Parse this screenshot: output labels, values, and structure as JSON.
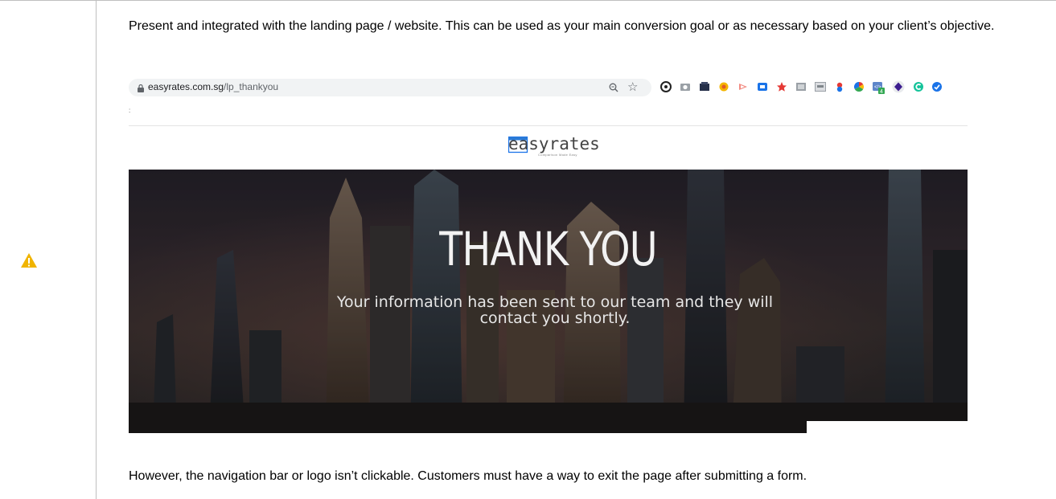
{
  "doc": {
    "intro": "Present and integrated with the landing page / website. This can be used as your main conversion goal or as necessary based on your client’s objective.",
    "outro": "However, the navigation bar or logo isn’t clickable. Customers must have a way to exit the page after submitting a form.",
    "warning_icon": "warning-triangle-icon",
    "warning_color": "#f0b400"
  },
  "browser": {
    "url_host": "easyrates.com.sg",
    "url_path": "/lp_thankyou",
    "icons": [
      "lock-icon",
      "zoom-icon",
      "star-icon"
    ],
    "extension_icons": [
      "extension-icon-1",
      "extension-icon-2",
      "extension-icon-3",
      "extension-icon-4",
      "extension-icon-5",
      "extension-icon-6",
      "extension-icon-7",
      "extension-icon-8",
      "extension-icon-9",
      "extension-icon-10",
      "extension-icon-11",
      "extension-icon-12",
      "extension-icon-13",
      "extension-icon-14"
    ],
    "extension_badge": "4"
  },
  "site": {
    "logo": "easyrates",
    "logo_tagline": "Comparison Made Easy",
    "hero_title": "THANK YOU",
    "hero_message_line1": "Your information has been sent to our team and they will",
    "hero_message_line2": "contact you shortly."
  }
}
